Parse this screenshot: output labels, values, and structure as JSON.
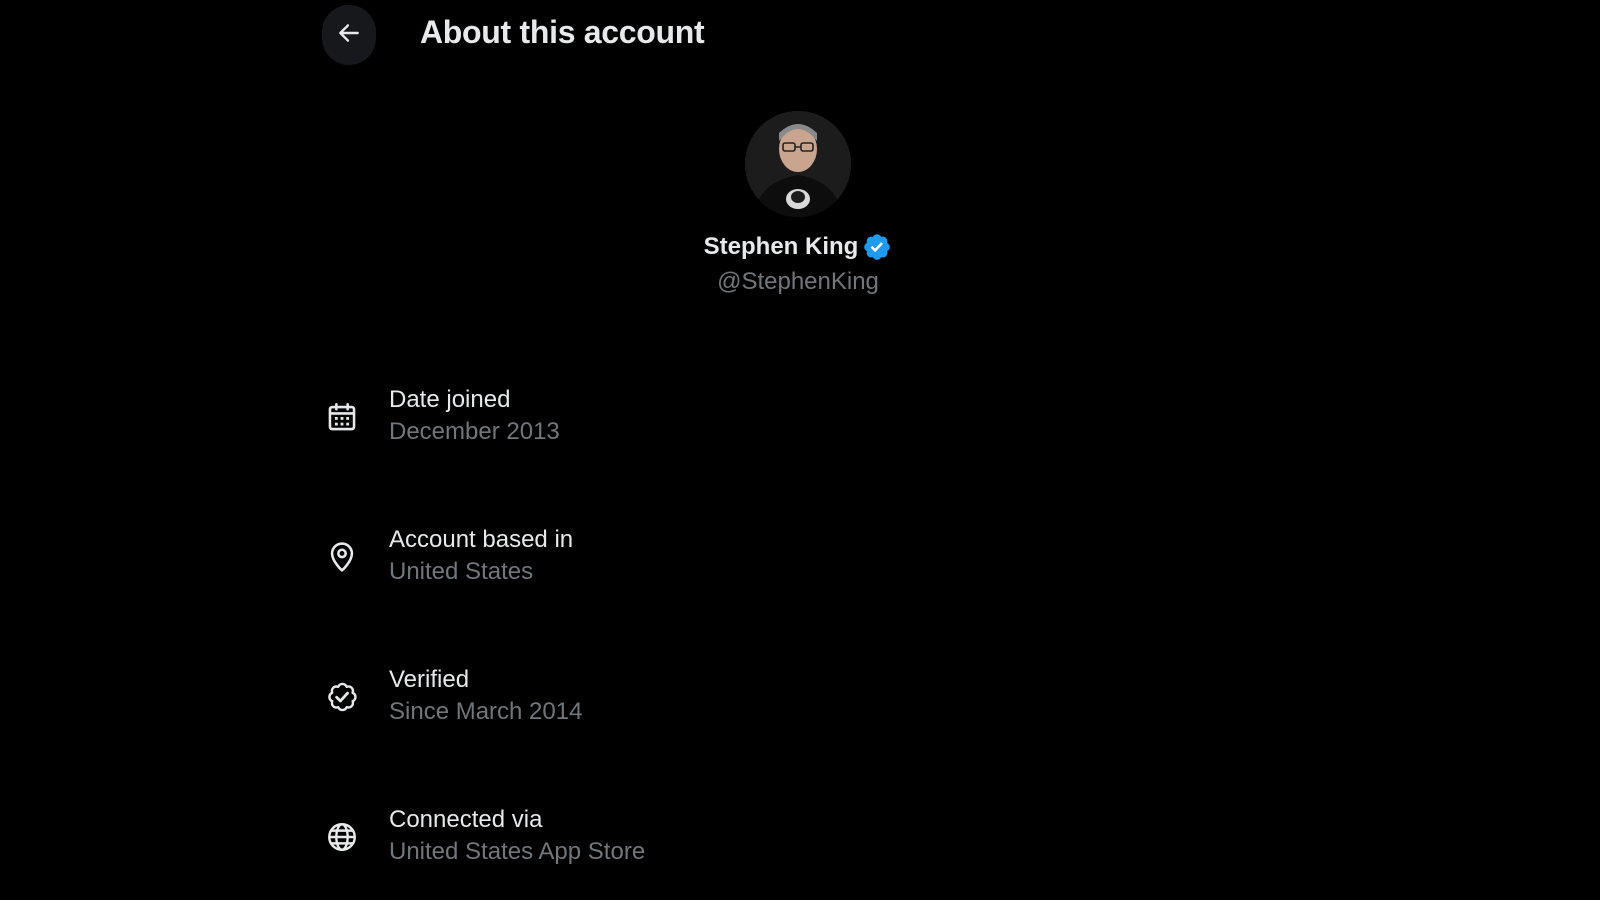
{
  "header": {
    "title": "About this account",
    "back_icon": "arrow-left-icon"
  },
  "profile": {
    "display_name": "Stephen King",
    "handle": "@StephenKing",
    "verified": true,
    "badge_color": "#1d9bf0"
  },
  "details": [
    {
      "icon": "calendar-icon",
      "label": "Date joined",
      "value": "December 2013"
    },
    {
      "icon": "location-pin-icon",
      "label": "Account based in",
      "value": "United States"
    },
    {
      "icon": "verified-outline-icon",
      "label": "Verified",
      "value": "Since March 2014"
    },
    {
      "icon": "globe-icon",
      "label": "Connected via",
      "value": "United States App Store"
    }
  ],
  "colors": {
    "background": "#000000",
    "primary_text": "#e7e9ea",
    "secondary_text": "#71767b",
    "accent": "#1d9bf0"
  }
}
